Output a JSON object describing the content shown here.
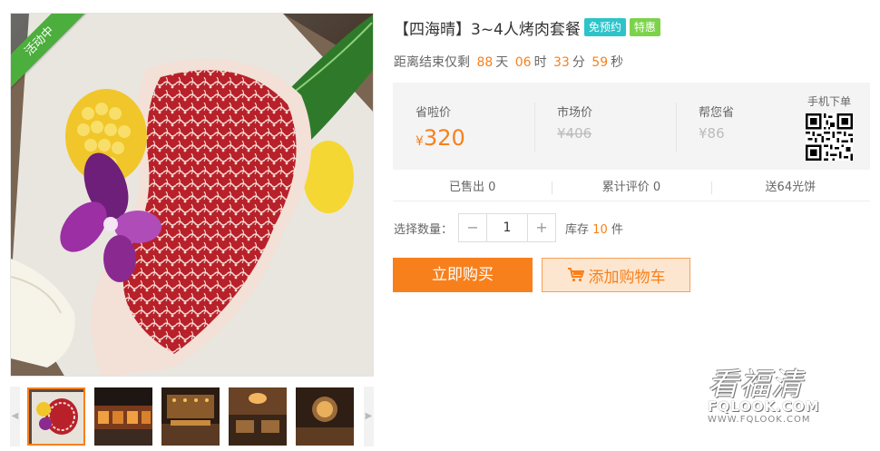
{
  "gallery": {
    "badge": "活动中",
    "thumb_count": 5,
    "prev_icon": "chevron-left-icon",
    "next_icon": "chevron-right-icon"
  },
  "product": {
    "title": "【四海晴】3~4人烤肉套餐",
    "tags": [
      "免预约",
      "特惠"
    ]
  },
  "countdown": {
    "prefix": "距离结束仅剩",
    "days": "88",
    "days_unit": "天",
    "hours": "06",
    "hours_unit": "时",
    "minutes": "33",
    "minutes_unit": "分",
    "seconds": "59",
    "seconds_unit": "秒"
  },
  "price": {
    "sale_label": "省啦价",
    "currency": "¥",
    "sale_value": "320",
    "market_label": "市场价",
    "market_value": "¥406",
    "save_label": "帮您省",
    "save_value": "¥86",
    "mobile_label": "手机下单"
  },
  "stats": {
    "sold": "已售出 0",
    "reviews": "累计评价 0",
    "gift": "送64光饼"
  },
  "quantity": {
    "label": "选择数量：",
    "minus": "−",
    "value": "1",
    "plus": "+",
    "stock_prefix": "库存",
    "stock_value": "10",
    "stock_unit": "件"
  },
  "actions": {
    "buy_label": "立即购买",
    "cart_label": "添加购物车"
  },
  "watermark": {
    "main": "看福清",
    "domain": "FQLOOK.COM",
    "url": "WWW.FQLOOK.COM"
  },
  "colors": {
    "accent": "#f7801c",
    "badge_green": "#4cae3c",
    "tag_free": "#2dc4c9",
    "tag_sale": "#7cd34a"
  }
}
